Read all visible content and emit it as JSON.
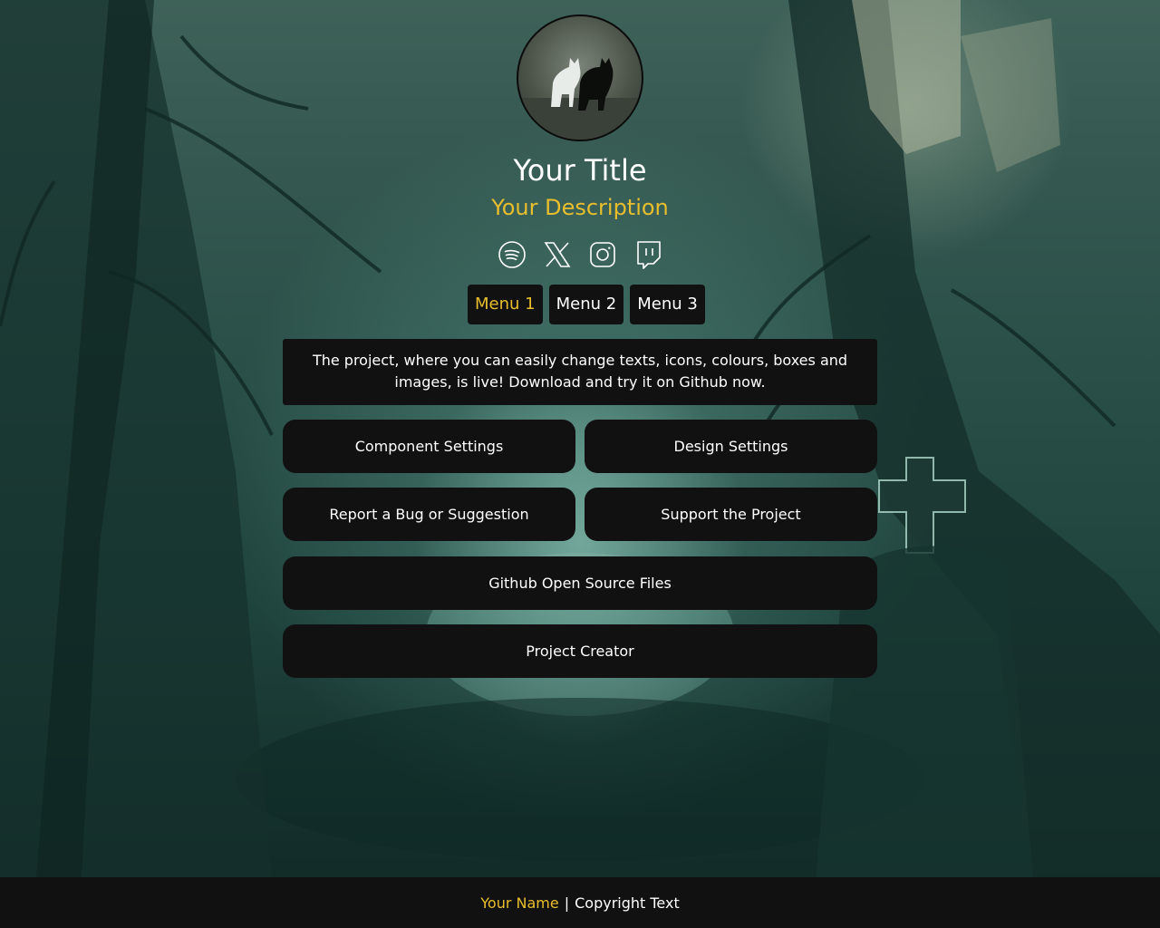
{
  "profile": {
    "title": "Your Title",
    "description": "Your Description"
  },
  "socials": [
    {
      "name": "spotify-icon"
    },
    {
      "name": "x-icon"
    },
    {
      "name": "instagram-icon"
    },
    {
      "name": "twitch-icon"
    }
  ],
  "menus": [
    {
      "label": "Menu 1",
      "active": true
    },
    {
      "label": "Menu 2",
      "active": false
    },
    {
      "label": "Menu 3",
      "active": false
    }
  ],
  "announcement": {
    "text": "The project, where you can easily change texts, icons, colours, boxes and images, is live! Download and try it on Github now."
  },
  "links": {
    "component_settings": "Component Settings",
    "design_settings": "Design Settings",
    "report_bug": "Report a Bug or Suggestion",
    "support_project": "Support the Project",
    "github_files": "Github Open Source Files",
    "project_creator": "Project Creator"
  },
  "footer": {
    "name": "Your Name",
    "separator": "|",
    "copyright": "Copyright Text"
  },
  "colors": {
    "accent": "#e8be2c",
    "panel": "#111111",
    "text": "#ffffff"
  }
}
